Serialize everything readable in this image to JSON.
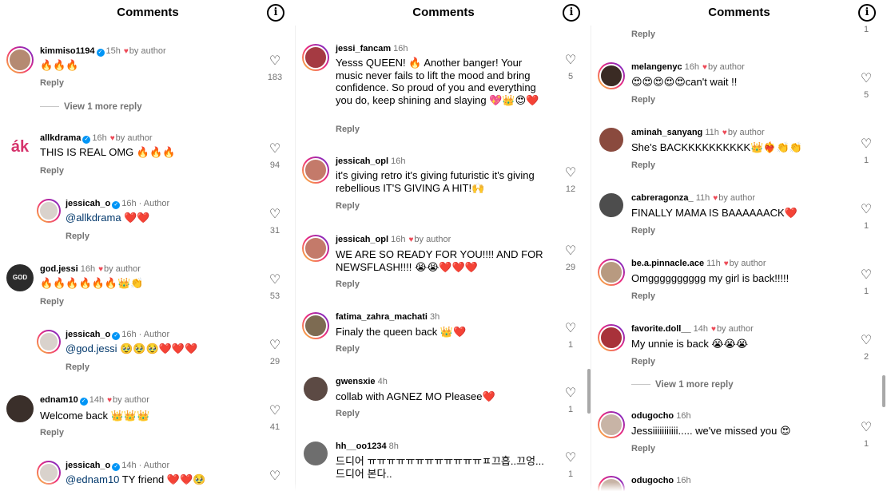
{
  "header": {
    "title": "Comments",
    "info_glyph": "i"
  },
  "reply_label": "Reply",
  "panel1": {
    "c1": {
      "user": "kimmiso1194",
      "time": "15h",
      "liked": "by author",
      "text": "🔥🔥🔥",
      "likes": "183",
      "view_more": "View 1 more reply"
    },
    "c2": {
      "user": "allkdrama",
      "time": "16h",
      "liked": "by author",
      "text": "THIS IS REAL OMG 🔥🔥🔥",
      "likes": "94"
    },
    "c3": {
      "user": "jessicah_o",
      "time": "16h · Author",
      "mention": "@allkdrama",
      "text": " ❤️❤️",
      "likes": "31"
    },
    "c4": {
      "user": "god.jessi",
      "time": "16h",
      "liked": "by author",
      "text": "🔥🔥🔥🔥🔥🔥👑👏",
      "likes": "53"
    },
    "c5": {
      "user": "jessicah_o",
      "time": "16h · Author",
      "mention": "@god.jessi",
      "text": " 🥹🥹🥹❤️❤️❤️",
      "likes": "29"
    },
    "c6": {
      "user": "ednam10",
      "time": "14h",
      "liked": "by author",
      "text": "Welcome back 👑👑👑",
      "likes": "41"
    },
    "c7": {
      "user": "jessicah_o",
      "time": "14h · Author",
      "mention": "@ednam10",
      "text": " TY friend ❤️❤️🥹"
    }
  },
  "panel2": {
    "c1": {
      "user": "jessi_fancam",
      "time": "16h",
      "text": "Yesss QUEEN! 🔥 Another banger! Your music never fails to lift the mood and bring confidence. So proud of you and everything you do, keep shining and slaying 💖👑😍❤️",
      "likes": "5"
    },
    "c2": {
      "user": "jessicah_opl",
      "time": "16h",
      "text": "it's giving retro it's giving futuristic it's giving rebellious IT'S GIVING A HIT!🙌",
      "likes": "12"
    },
    "c3": {
      "user": "jessicah_opl",
      "time": "16h",
      "liked": "by author",
      "text": "WE ARE SO READY FOR YOU!!!! AND FOR NEWSFLASH!!!! 😭😭❤️❤️❤️",
      "likes": "29"
    },
    "c4": {
      "user": "fatima_zahra_machati",
      "time": "3h",
      "text": "Finaly the queen back 👑❤️",
      "likes": "1"
    },
    "c5": {
      "user": "gwensxie",
      "time": "4h",
      "text": "collab with AGNEZ MO Pleasee❤️",
      "likes": "1"
    },
    "c6": {
      "user": "hh__oo1234",
      "time": "8h",
      "text": "드디어 ㅠㅠㅠㅠㅠㅠㅠㅠㅠㅠㅠㅠㅍ끄흡..끄엉...드디어 본다..",
      "likes": "1"
    }
  },
  "panel3": {
    "top_likes": "1",
    "c1": {
      "user": "melangenyc",
      "time": "16h",
      "liked": "by author",
      "text": "😍😍😍😍😍can't wait !!",
      "likes": "5"
    },
    "c2": {
      "user": "aminah_sanyang",
      "time": "11h",
      "liked": "by author",
      "text": "She's BACKKKKKKKKKK👑❤️‍🔥👏👏",
      "likes": "1"
    },
    "c3": {
      "user": "cabreragonza_",
      "time": "11h",
      "liked": "by author",
      "text": "FINALLY MAMA IS BAAAAAACK❤️",
      "likes": "1"
    },
    "c4": {
      "user": "be.a.pinnacle.ace",
      "time": "11h",
      "liked": "by author",
      "text": "Omgggggggggg my girl is back!!!!!",
      "likes": "1"
    },
    "c5": {
      "user": "favorite.doll__",
      "time": "14h",
      "liked": "by author",
      "text": "My unnie is back 😭😭😭",
      "likes": "2",
      "view_more": "View 1 more reply"
    },
    "c6": {
      "user": "odugocho",
      "time": "16h",
      "text": "Jessiiiiiiiiiii..... we've missed you 😍",
      "likes": "1"
    },
    "c7": {
      "user": "odugocho",
      "time": "16h"
    }
  },
  "colors": {
    "verified": "#0095f6",
    "heart": "#ed4956",
    "mention": "#00376b",
    "meta": "#737373"
  },
  "icons": {
    "like": "heart-outline-icon",
    "info": "info-circle-icon",
    "verified": "verified-badge-icon"
  }
}
